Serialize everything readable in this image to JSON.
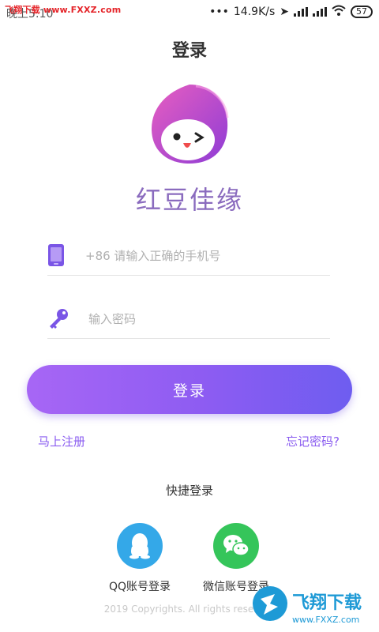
{
  "status": {
    "time": "晚上5:10",
    "net_speed": "14.9K/s",
    "battery": "57",
    "watermark": "飞翔下载 www.FXXZ.com"
  },
  "header": {
    "title": "登录"
  },
  "brand": {
    "name": "红豆佳缘"
  },
  "form": {
    "phone_placeholder": "+86 请输入正确的手机号",
    "password_placeholder": "输入密码",
    "login_label": "登录"
  },
  "links": {
    "register": "马上注册",
    "forgot": "忘记密码?"
  },
  "quick_login": {
    "title": "快捷登录",
    "qq_label": "QQ账号登录",
    "wechat_label": "微信账号登录"
  },
  "footer": {
    "copyright": "2019 Copyrights. All rights reserved"
  },
  "colors": {
    "accent": "#8a5cf0",
    "qq": "#34a8e8",
    "wechat": "#35c55a"
  },
  "icons": [
    "phone-icon",
    "key-icon",
    "qq-icon",
    "wechat-icon"
  ],
  "watermark_bottom": {
    "text": "飞翔下载",
    "url": "www.FXXZ.com"
  }
}
